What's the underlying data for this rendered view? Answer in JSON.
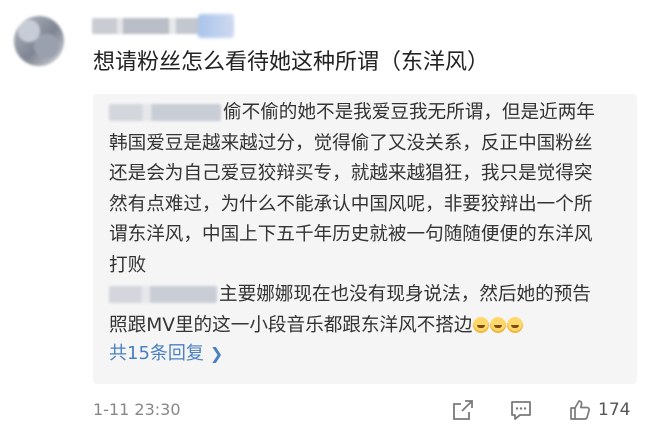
{
  "comment": {
    "text": "想请粉丝怎么看待她这种所谓（东洋风）"
  },
  "reply": {
    "lines": [
      "偷不偷的她不是我爱豆我无所谓，但是近两年",
      "韩国爱豆是越来越过分，觉得偷了又没关系，反正中国粉丝",
      "还是会为自己爱豆狡辩买专，就越来越猖狂，我只是觉得突",
      "然有点难过，为什么不能承认中国风呢，非要狡辩出一个所",
      "谓东洋风，中国上下五千年历史就被一句随随便便的东洋风",
      "打败"
    ]
  },
  "reply2": {
    "lines": [
      "主要娜娜现在也没有现身说法，然后她的预告",
      "照跟MV里的这一小段音乐都跟东洋风不搭边"
    ]
  },
  "more_replies_label": "共15条回复",
  "footer": {
    "timestamp": "1-11 23:30",
    "like_count": "174"
  },
  "icons": {
    "share": "share-icon",
    "comment": "comment-icon",
    "like": "thumbs-up-icon",
    "more_chevron": "chevron-right-icon",
    "emoji": "crying-face-emoji-icon"
  },
  "colors": {
    "link": "#4a7fc1",
    "quote_bg": "#f5f5f6"
  }
}
